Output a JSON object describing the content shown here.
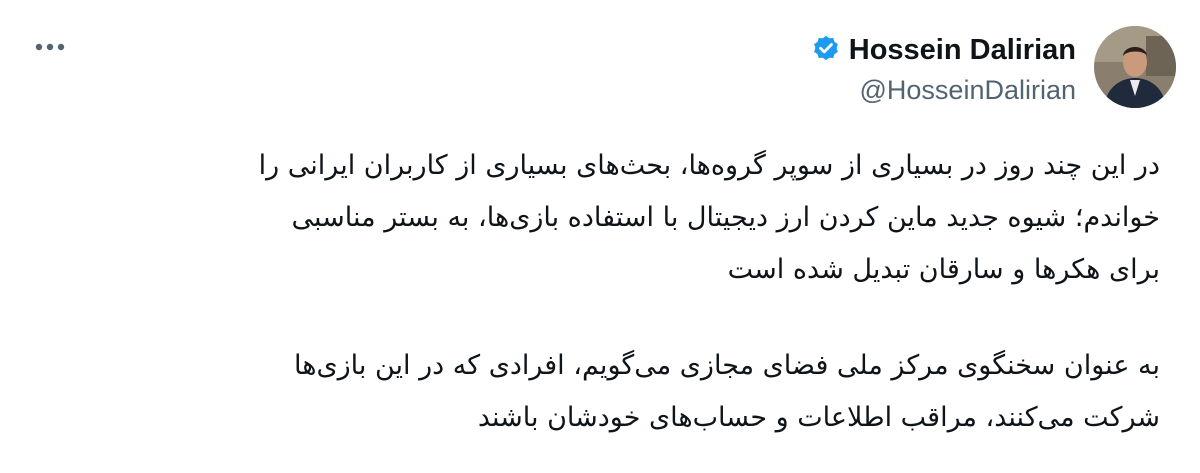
{
  "author": {
    "display_name": "Hossein Dalirian",
    "handle": "@HosseinDalirian",
    "verified": true
  },
  "colors": {
    "verified_badge": "#1d9bf0",
    "handle_text": "#536471",
    "body_text": "#0f1419"
  },
  "icons": {
    "more": "more-options-icon",
    "verified": "verified-badge-icon"
  },
  "tweet": {
    "paragraph_1_line_1": "در این چند روز در بسیاری از سوپر گروه‌ها، بحث‌های بسیاری از کاربران ایرانی را",
    "paragraph_1_line_2": "خواندم؛ شیوه جدید ماین کردن ارز دیجیتال با استفاده بازی‌ها، به بستر مناسبی",
    "paragraph_1_line_3": "برای هکرها و سارقان تبدیل شده است",
    "paragraph_2_line_1": "به عنوان سخنگوی مرکز ملی فضای مجازی می‌گویم، افرادی که در این بازی‌ها",
    "paragraph_2_line_2": "شرکت می‌کنند، مراقب اطلاعات و حساب‌های خودشان باشند"
  }
}
